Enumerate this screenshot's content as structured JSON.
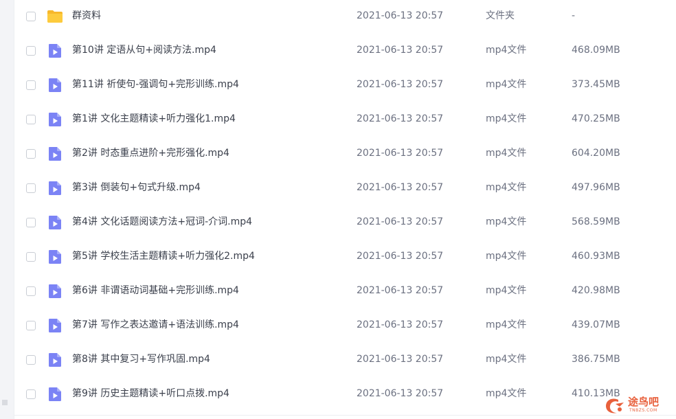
{
  "files": [
    {
      "name": "群资料",
      "date": "2021-06-13 20:57",
      "type": "文件夹",
      "size": "-",
      "icon": "folder-icon"
    },
    {
      "name": "第10讲 定语从句+阅读方法.mp4",
      "date": "2021-06-13 20:57",
      "type": "mp4文件",
      "size": "468.09MB",
      "icon": "video-file-icon"
    },
    {
      "name": "第11讲 祈使句-强调句+完形训练.mp4",
      "date": "2021-06-13 20:57",
      "type": "mp4文件",
      "size": "373.45MB",
      "icon": "video-file-icon"
    },
    {
      "name": "第1讲 文化主题精读+听力强化1.mp4",
      "date": "2021-06-13 20:57",
      "type": "mp4文件",
      "size": "470.25MB",
      "icon": "video-file-icon"
    },
    {
      "name": "第2讲 时态重点进阶+完形强化.mp4",
      "date": "2021-06-13 20:57",
      "type": "mp4文件",
      "size": "604.20MB",
      "icon": "video-file-icon"
    },
    {
      "name": "第3讲 倒装句+句式升级.mp4",
      "date": "2021-06-13 20:57",
      "type": "mp4文件",
      "size": "497.96MB",
      "icon": "video-file-icon"
    },
    {
      "name": "第4讲 文化话题阅读方法+冠词-介词.mp4",
      "date": "2021-06-13 20:57",
      "type": "mp4文件",
      "size": "568.59MB",
      "icon": "video-file-icon"
    },
    {
      "name": "第5讲 学校生活主题精读+听力强化2.mp4",
      "date": "2021-06-13 20:57",
      "type": "mp4文件",
      "size": "460.93MB",
      "icon": "video-file-icon"
    },
    {
      "name": "第6讲 非谓语动词基础+完形训练.mp4",
      "date": "2021-06-13 20:57",
      "type": "mp4文件",
      "size": "420.98MB",
      "icon": "video-file-icon"
    },
    {
      "name": "第7讲  写作之表达邀请+语法训练.mp4",
      "date": "2021-06-13 20:57",
      "type": "mp4文件",
      "size": "439.07MB",
      "icon": "video-file-icon"
    },
    {
      "name": "第8讲 其中复习+写作巩固.mp4",
      "date": "2021-06-13 20:57",
      "type": "mp4文件",
      "size": "386.75MB",
      "icon": "video-file-icon"
    },
    {
      "name": "第9讲 历史主题精读+听口点拨.mp4",
      "date": "2021-06-13 20:57",
      "type": "mp4文件",
      "size": "410.13MB",
      "icon": "video-file-icon"
    }
  ],
  "watermark": {
    "text": "途鸟吧",
    "sub": "TNBZS.COM"
  },
  "colors": {
    "folder": "#fdcb3d",
    "video": "#7b83f5",
    "watermark": "#e8603c"
  }
}
